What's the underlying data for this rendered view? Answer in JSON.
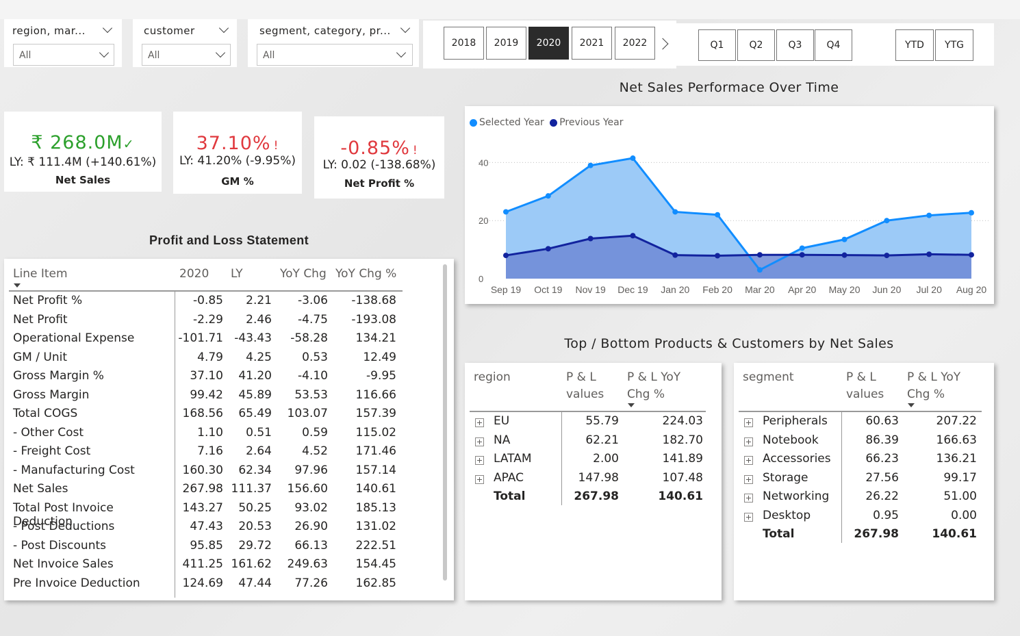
{
  "filters": [
    {
      "title": "region, mar...",
      "value": "All"
    },
    {
      "title": "customer",
      "value": "All"
    },
    {
      "title": "segment, category, pr...",
      "value": "All"
    }
  ],
  "years": [
    "2018",
    "2019",
    "2020",
    "2021",
    "2022"
  ],
  "selected_year": "2020",
  "quarters": [
    "Q1",
    "Q2",
    "Q3",
    "Q4"
  ],
  "periods": [
    "YTD",
    "YTG"
  ],
  "kpis": [
    {
      "value": "₹ 268.0M",
      "flag": "✓",
      "ly": "LY: ₹ 111.4M (+140.61%)",
      "label": "Net Sales",
      "color": "#2ca02c"
    },
    {
      "value": "37.10%",
      "flag": "!",
      "ly": "LY: 41.20% (-9.95%)",
      "label": "GM %",
      "color": "#e0393e"
    },
    {
      "value": "-0.85%",
      "flag": "!",
      "ly": "LY: 0.02 (-138.68%)",
      "label": "Net Profit %",
      "color": "#e0393e"
    }
  ],
  "pl": {
    "title": "Profit and Loss Statement",
    "headers": [
      "Line Item",
      "2020",
      "LY",
      "YoY Chg",
      "YoY Chg %"
    ],
    "rows": [
      [
        "Net Profit %",
        "-0.85",
        "2.21",
        "-3.06",
        "-138.68"
      ],
      [
        "Net Profit",
        "-2.29",
        "2.46",
        "-4.75",
        "-193.08"
      ],
      [
        "Operational Expense",
        "-101.71",
        "-43.43",
        "-58.28",
        "134.21"
      ],
      [
        "GM / Unit",
        "4.79",
        "4.25",
        "0.53",
        "12.49"
      ],
      [
        "Gross Margin %",
        "37.10",
        "41.20",
        "-4.10",
        "-9.95"
      ],
      [
        "Gross Margin",
        "99.42",
        "45.89",
        "53.53",
        "116.66"
      ],
      [
        "Total COGS",
        "168.56",
        "65.49",
        "103.07",
        "157.39"
      ],
      [
        "- Other Cost",
        "1.10",
        "0.51",
        "0.59",
        "115.02"
      ],
      [
        "- Freight Cost",
        "7.16",
        "2.64",
        "4.52",
        "171.46"
      ],
      [
        "- Manufacturing Cost",
        "160.30",
        "62.34",
        "97.96",
        "157.14"
      ],
      [
        "Net Sales",
        "267.98",
        "111.37",
        "156.60",
        "140.61"
      ],
      [
        "Total Post Invoice Deduction",
        "143.27",
        "50.25",
        "93.02",
        "185.13"
      ],
      [
        "- Post Deductions",
        "47.43",
        "20.53",
        "26.90",
        "131.02"
      ],
      [
        "- Post Discounts",
        "95.85",
        "29.72",
        "66.13",
        "222.51"
      ],
      [
        "Net Invoice Sales",
        "411.25",
        "161.62",
        "249.63",
        "154.45"
      ],
      [
        "Pre Invoice Deduction",
        "124.69",
        "47.44",
        "77.26",
        "162.85"
      ]
    ]
  },
  "chart_title": "Net Sales Performace Over Time",
  "chart_data": {
    "type": "area",
    "categories": [
      "Sep 19",
      "Oct 19",
      "Nov 19",
      "Dec 19",
      "Jan 20",
      "Feb 20",
      "Mar 20",
      "Apr 20",
      "May 20",
      "Jun 20",
      "Jul 20",
      "Aug 20"
    ],
    "series": [
      {
        "name": "Selected Year",
        "color": "#118dff",
        "values": [
          23,
          28.5,
          39,
          41.5,
          23,
          22,
          3,
          10.5,
          13.5,
          20,
          21.8,
          22.7
        ]
      },
      {
        "name": "Previous Year",
        "color": "#12239e",
        "values": [
          8,
          10.3,
          13.8,
          14.8,
          8.1,
          7.9,
          8.2,
          8.2,
          8.1,
          8.0,
          8.4,
          8.2
        ]
      }
    ],
    "yticks": [
      0,
      20,
      40
    ],
    "ylim": [
      0,
      50
    ],
    "legend": "top-left",
    "grid": true
  },
  "tb_title": "Top / Bottom Products & Customers by Net Sales",
  "region_table": {
    "headers": [
      "region",
      "P & L values",
      "P & L YoY Chg %"
    ],
    "rows": [
      [
        "EU",
        "55.79",
        "224.03"
      ],
      [
        "NA",
        "62.21",
        "182.70"
      ],
      [
        "LATAM",
        "2.00",
        "141.89"
      ],
      [
        "APAC",
        "147.98",
        "107.48"
      ]
    ],
    "total": [
      "Total",
      "267.98",
      "140.61"
    ]
  },
  "segment_table": {
    "headers": [
      "segment",
      "P & L values",
      "P & L YoY Chg %"
    ],
    "rows": [
      [
        "Peripherals",
        "60.63",
        "207.22"
      ],
      [
        "Notebook",
        "86.39",
        "166.63"
      ],
      [
        "Accessories",
        "66.23",
        "136.21"
      ],
      [
        "Storage",
        "27.56",
        "99.17"
      ],
      [
        "Networking",
        "26.22",
        "51.00"
      ],
      [
        "Desktop",
        "0.95",
        "0.00"
      ]
    ],
    "total": [
      "Total",
      "267.98",
      "140.61"
    ]
  }
}
